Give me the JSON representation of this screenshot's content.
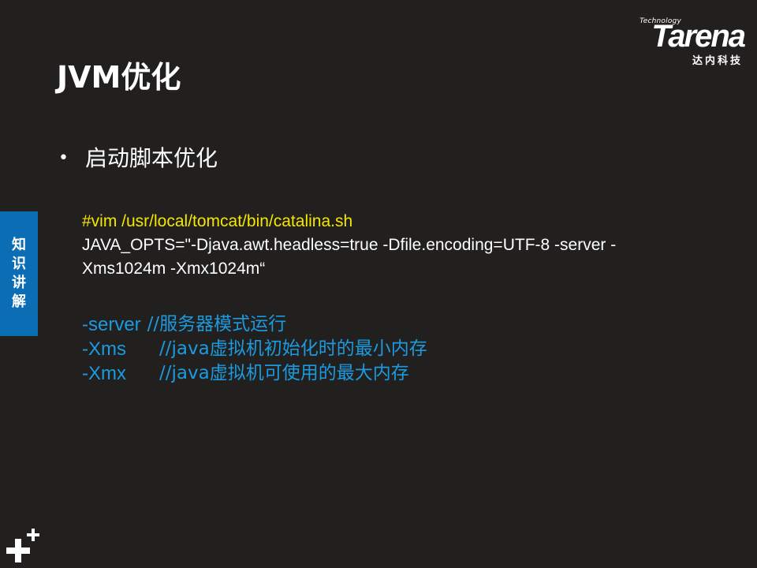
{
  "logo": {
    "tech": "Technology",
    "word": "Tarena",
    "cn": "达内科技"
  },
  "title": "JVM优化",
  "bullet": "启动脚本优化",
  "code": {
    "line1": "#vim  /usr/local/tomcat/bin/catalina.sh",
    "line2": "JAVA_OPTS=\"-Djava.awt.headless=true -Dfile.encoding=UTF-8 -server -",
    "line3": "Xms1024m -Xmx1024m“"
  },
  "options": [
    {
      "flag": "-server",
      "comment": "//服务器模式运行"
    },
    {
      "flag": "-Xms",
      "comment": "//java虚拟机初始化时的最小内存"
    },
    {
      "flag": "-Xmx",
      "comment": "//java虚拟机可使用的最大内存"
    }
  ],
  "side_tab": [
    "知",
    "识",
    "讲",
    "解"
  ],
  "colors": {
    "background": "#221f1f",
    "accent_blue": "#1a9be0",
    "yellow": "#f5e600",
    "tab_blue": "#0b6db4"
  },
  "icons": {
    "corner": "plus-plus-icon"
  }
}
